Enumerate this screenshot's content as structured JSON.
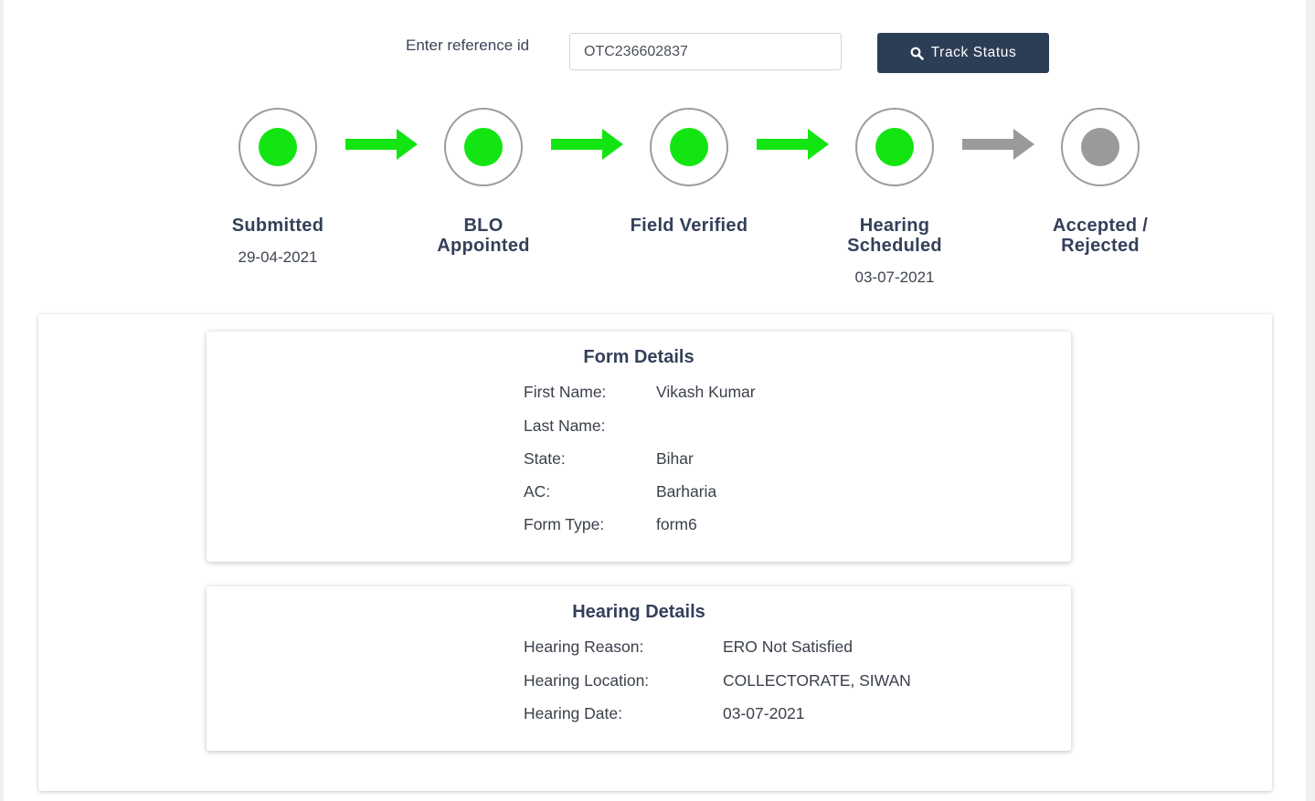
{
  "search": {
    "label": "Enter reference id",
    "value": "OTC236602837",
    "button_label": "Track Status",
    "button_icon": "search-icon"
  },
  "colors": {
    "complete": "#13e513",
    "pending": "#9a9a9a",
    "button": "#2c3e55"
  },
  "steps": [
    {
      "title_line1": "Submitted",
      "title_line2": "",
      "date": "29-04-2021",
      "status": "complete"
    },
    {
      "title_line1": "BLO",
      "title_line2": "Appointed",
      "date": "",
      "status": "complete"
    },
    {
      "title_line1": "Field Verified",
      "title_line2": "",
      "date": "",
      "status": "complete"
    },
    {
      "title_line1": "Hearing",
      "title_line2": "Scheduled",
      "date": "03-07-2021",
      "status": "complete"
    },
    {
      "title_line1": "Accepted /",
      "title_line2": "Rejected",
      "date": "",
      "status": "pending"
    }
  ],
  "form_details": {
    "title": "Form Details",
    "rows": [
      {
        "label": "First Name:",
        "value": "Vikash Kumar"
      },
      {
        "label": "Last Name:",
        "value": ""
      },
      {
        "label": "State:",
        "value": "Bihar"
      },
      {
        "label": "AC:",
        "value": "Barharia"
      },
      {
        "label": "Form Type:",
        "value": "form6"
      }
    ]
  },
  "hearing_details": {
    "title": "Hearing Details",
    "rows": [
      {
        "label": "Hearing Reason:",
        "value": "ERO Not Satisfied"
      },
      {
        "label": "Hearing Location:",
        "value": "COLLECTORATE, SIWAN"
      },
      {
        "label": "Hearing Date:",
        "value": "03-07-2021"
      }
    ]
  }
}
